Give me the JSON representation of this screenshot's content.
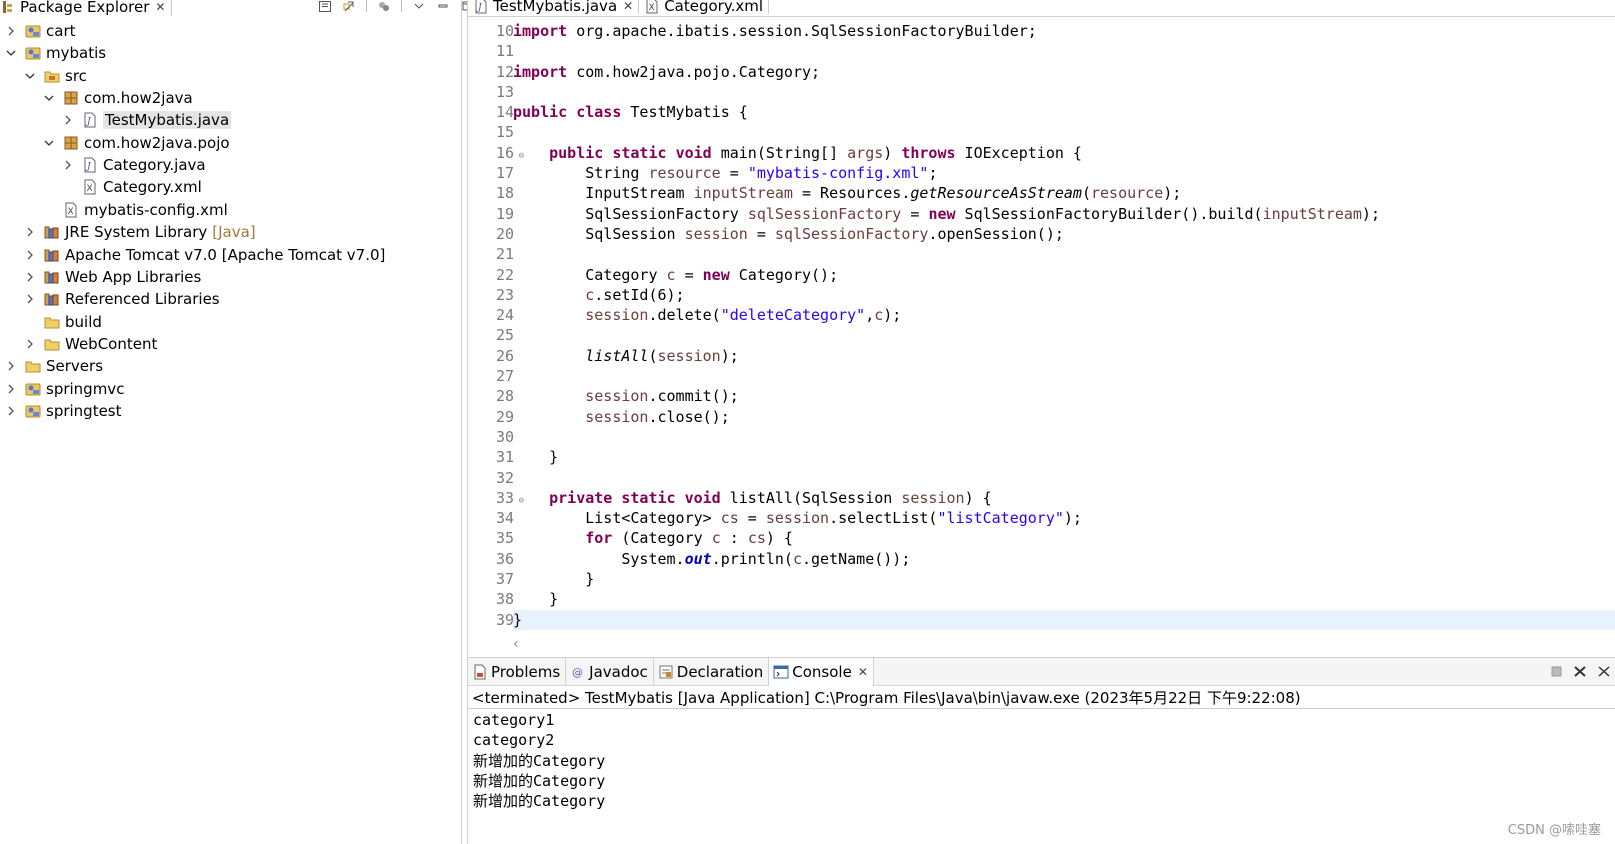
{
  "package_explorer": {
    "title": "Package Explorer",
    "tree": [
      {
        "label": "cart",
        "suffix": "",
        "depth": 0,
        "expanded": false,
        "has_children": true,
        "icon": "project-icon"
      },
      {
        "label": "mybatis",
        "suffix": "",
        "depth": 0,
        "expanded": true,
        "has_children": true,
        "icon": "project-icon"
      },
      {
        "label": "src",
        "suffix": "",
        "depth": 1,
        "expanded": true,
        "has_children": true,
        "icon": "source-folder-icon"
      },
      {
        "label": "com.how2java",
        "suffix": "",
        "depth": 2,
        "expanded": true,
        "has_children": true,
        "icon": "package-icon"
      },
      {
        "label": "TestMybatis.java",
        "suffix": "",
        "depth": 3,
        "expanded": false,
        "has_children": true,
        "icon": "java-file-icon",
        "selected": true
      },
      {
        "label": "com.how2java.pojo",
        "suffix": "",
        "depth": 2,
        "expanded": true,
        "has_children": true,
        "icon": "package-icon"
      },
      {
        "label": "Category.java",
        "suffix": "",
        "depth": 3,
        "expanded": false,
        "has_children": true,
        "icon": "java-file-icon"
      },
      {
        "label": "Category.xml",
        "suffix": "",
        "depth": 3,
        "expanded": false,
        "has_children": false,
        "icon": "xml-file-icon"
      },
      {
        "label": "mybatis-config.xml",
        "suffix": "",
        "depth": 2,
        "expanded": false,
        "has_children": false,
        "icon": "xml-file-icon"
      },
      {
        "label": "JRE System Library",
        "suffix": "[Java]",
        "depth": 1,
        "expanded": false,
        "has_children": true,
        "icon": "library-icon"
      },
      {
        "label": "Apache Tomcat v7.0 [Apache Tomcat v7.0]",
        "suffix": "",
        "depth": 1,
        "expanded": false,
        "has_children": true,
        "icon": "library-icon"
      },
      {
        "label": "Web App Libraries",
        "suffix": "",
        "depth": 1,
        "expanded": false,
        "has_children": true,
        "icon": "library-icon"
      },
      {
        "label": "Referenced Libraries",
        "suffix": "",
        "depth": 1,
        "expanded": false,
        "has_children": true,
        "icon": "library-icon"
      },
      {
        "label": "build",
        "suffix": "",
        "depth": 1,
        "expanded": false,
        "has_children": false,
        "icon": "folder-icon"
      },
      {
        "label": "WebContent",
        "suffix": "",
        "depth": 1,
        "expanded": false,
        "has_children": true,
        "icon": "folder-icon"
      },
      {
        "label": "Servers",
        "suffix": "",
        "depth": 0,
        "expanded": false,
        "has_children": true,
        "icon": "folder-icon"
      },
      {
        "label": "springmvc",
        "suffix": "",
        "depth": 0,
        "expanded": false,
        "has_children": true,
        "icon": "project-icon"
      },
      {
        "label": "springtest",
        "suffix": "",
        "depth": 0,
        "expanded": false,
        "has_children": true,
        "icon": "project-icon"
      }
    ]
  },
  "editor": {
    "tabs": [
      {
        "label": "TestMybatis.java",
        "icon": "java-file-icon",
        "active": true,
        "closable": true
      },
      {
        "label": "Category.xml",
        "icon": "xml-file-icon",
        "active": false,
        "closable": false
      }
    ],
    "current_line": 39,
    "lines": [
      {
        "n": "10",
        "fold": false,
        "tokens": [
          [
            "kw",
            "import"
          ],
          [
            "p",
            " org.apache.ibatis.session.SqlSessionFactoryBuilder;"
          ]
        ]
      },
      {
        "n": "11",
        "fold": false,
        "tokens": []
      },
      {
        "n": "12",
        "fold": false,
        "tokens": [
          [
            "kw",
            "import"
          ],
          [
            "p",
            " com.how2java.pojo.Category;"
          ]
        ]
      },
      {
        "n": "13",
        "fold": false,
        "tokens": []
      },
      {
        "n": "14",
        "fold": false,
        "tokens": [
          [
            "kw",
            "public"
          ],
          [
            "p",
            " "
          ],
          [
            "kw",
            "class"
          ],
          [
            "p",
            " TestMybatis {"
          ]
        ]
      },
      {
        "n": "15",
        "fold": false,
        "tokens": []
      },
      {
        "n": "16",
        "fold": true,
        "tokens": [
          [
            "p",
            "    "
          ],
          [
            "kw",
            "public"
          ],
          [
            "p",
            " "
          ],
          [
            "kw",
            "static"
          ],
          [
            "p",
            " "
          ],
          [
            "kw",
            "void"
          ],
          [
            "p",
            " main(String[] "
          ],
          [
            "fld",
            "args"
          ],
          [
            "p",
            ") "
          ],
          [
            "kw",
            "throws"
          ],
          [
            "p",
            " IOException {"
          ]
        ]
      },
      {
        "n": "17",
        "fold": false,
        "tokens": [
          [
            "p",
            "        String "
          ],
          [
            "fld",
            "resource"
          ],
          [
            "p",
            " = "
          ],
          [
            "str",
            "\"mybatis-config.xml\""
          ],
          [
            "p",
            ";"
          ]
        ]
      },
      {
        "n": "18",
        "fold": false,
        "tokens": [
          [
            "p",
            "        InputStream "
          ],
          [
            "fld",
            "inputStream"
          ],
          [
            "p",
            " = Resources."
          ],
          [
            "it",
            "getResourceAsStream"
          ],
          [
            "p",
            "("
          ],
          [
            "fld",
            "resource"
          ],
          [
            "p",
            ");"
          ]
        ]
      },
      {
        "n": "19",
        "fold": false,
        "tokens": [
          [
            "p",
            "        SqlSessionFactory "
          ],
          [
            "fld",
            "sqlSessionFactory"
          ],
          [
            "p",
            " = "
          ],
          [
            "kw",
            "new"
          ],
          [
            "p",
            " SqlSessionFactoryBuilder().build("
          ],
          [
            "fld",
            "inputStream"
          ],
          [
            "p",
            ");"
          ]
        ]
      },
      {
        "n": "20",
        "fold": false,
        "tokens": [
          [
            "p",
            "        SqlSession "
          ],
          [
            "fld",
            "session"
          ],
          [
            "p",
            " = "
          ],
          [
            "fld",
            "sqlSessionFactory"
          ],
          [
            "p",
            ".openSession();"
          ]
        ]
      },
      {
        "n": "21",
        "fold": false,
        "tokens": []
      },
      {
        "n": "22",
        "fold": false,
        "tokens": [
          [
            "p",
            "        Category "
          ],
          [
            "fld",
            "c"
          ],
          [
            "p",
            " = "
          ],
          [
            "kw",
            "new"
          ],
          [
            "p",
            " Category();"
          ]
        ]
      },
      {
        "n": "23",
        "fold": false,
        "tokens": [
          [
            "p",
            "        "
          ],
          [
            "fld",
            "c"
          ],
          [
            "p",
            ".setId(6);"
          ]
        ]
      },
      {
        "n": "24",
        "fold": false,
        "tokens": [
          [
            "p",
            "        "
          ],
          [
            "fld",
            "session"
          ],
          [
            "p",
            ".delete("
          ],
          [
            "str",
            "\"deleteCategory\""
          ],
          [
            "p",
            ","
          ],
          [
            "fld",
            "c"
          ],
          [
            "p",
            ");"
          ]
        ]
      },
      {
        "n": "25",
        "fold": false,
        "tokens": []
      },
      {
        "n": "26",
        "fold": false,
        "tokens": [
          [
            "p",
            "        "
          ],
          [
            "it",
            "listAll"
          ],
          [
            "p",
            "("
          ],
          [
            "fld",
            "session"
          ],
          [
            "p",
            ");"
          ]
        ]
      },
      {
        "n": "27",
        "fold": false,
        "tokens": []
      },
      {
        "n": "28",
        "fold": false,
        "tokens": [
          [
            "p",
            "        "
          ],
          [
            "fld",
            "session"
          ],
          [
            "p",
            ".commit();"
          ]
        ]
      },
      {
        "n": "29",
        "fold": false,
        "tokens": [
          [
            "p",
            "        "
          ],
          [
            "fld",
            "session"
          ],
          [
            "p",
            ".close();"
          ]
        ]
      },
      {
        "n": "30",
        "fold": false,
        "tokens": []
      },
      {
        "n": "31",
        "fold": false,
        "tokens": [
          [
            "p",
            "    }"
          ]
        ]
      },
      {
        "n": "32",
        "fold": false,
        "tokens": []
      },
      {
        "n": "33",
        "fold": true,
        "tokens": [
          [
            "p",
            "    "
          ],
          [
            "kw",
            "private"
          ],
          [
            "p",
            " "
          ],
          [
            "kw",
            "static"
          ],
          [
            "p",
            " "
          ],
          [
            "kw",
            "void"
          ],
          [
            "p",
            " listAll(SqlSession "
          ],
          [
            "fld",
            "session"
          ],
          [
            "p",
            ") {"
          ]
        ]
      },
      {
        "n": "34",
        "fold": false,
        "tokens": [
          [
            "p",
            "        List<Category> "
          ],
          [
            "fld",
            "cs"
          ],
          [
            "p",
            " = "
          ],
          [
            "fld",
            "session"
          ],
          [
            "p",
            ".selectList("
          ],
          [
            "str",
            "\"listCategory\""
          ],
          [
            "p",
            ");"
          ]
        ]
      },
      {
        "n": "35",
        "fold": false,
        "tokens": [
          [
            "p",
            "        "
          ],
          [
            "kw",
            "for"
          ],
          [
            "p",
            " (Category "
          ],
          [
            "fld",
            "c"
          ],
          [
            "p",
            " : "
          ],
          [
            "fld",
            "cs"
          ],
          [
            "p",
            ") {"
          ]
        ]
      },
      {
        "n": "36",
        "fold": false,
        "tokens": [
          [
            "p",
            "            System."
          ],
          [
            "sfld",
            "out"
          ],
          [
            "p",
            ".println("
          ],
          [
            "fld",
            "c"
          ],
          [
            "p",
            ".getName());"
          ]
        ]
      },
      {
        "n": "37",
        "fold": false,
        "tokens": [
          [
            "p",
            "        }"
          ]
        ]
      },
      {
        "n": "38",
        "fold": false,
        "tokens": [
          [
            "p",
            "    }"
          ]
        ]
      },
      {
        "n": "39",
        "fold": false,
        "tokens": [
          [
            "p",
            "}"
          ]
        ]
      }
    ]
  },
  "console": {
    "tabs": [
      {
        "label": "Problems",
        "icon": "problems-icon",
        "active": false,
        "closable": false
      },
      {
        "label": "Javadoc",
        "icon": "javadoc-icon",
        "active": false,
        "closable": false
      },
      {
        "label": "Declaration",
        "icon": "declaration-icon",
        "active": false,
        "closable": false
      },
      {
        "label": "Console",
        "icon": "console-icon",
        "active": true,
        "closable": true
      }
    ],
    "status": "<terminated> TestMybatis [Java Application] C:\\Program Files\\Java\\bin\\javaw.exe (2023年5月22日 下午9:22:08)",
    "output": [
      "category1",
      "category2",
      "新增加的Category",
      "新增加的Category",
      "新增加的Category"
    ]
  },
  "watermark": "CSDN @嗦哇塞",
  "colors": {
    "keyword": "#7f0055",
    "string": "#2a00ff",
    "local_variable": "#6a3e3e",
    "static_field": "#0000c0",
    "current_line": "#e8f2fe"
  }
}
